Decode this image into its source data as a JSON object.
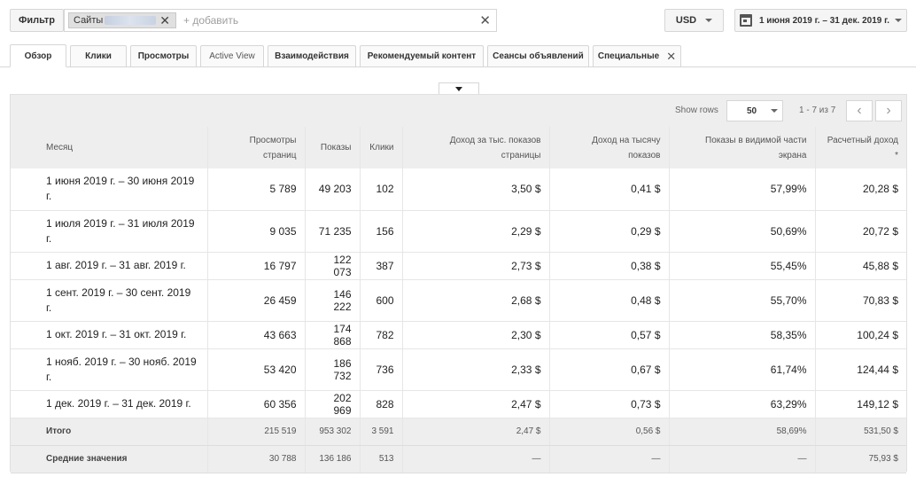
{
  "toolbar": {
    "filter_label": "Фильтр",
    "chip_label": "Сайты",
    "add_placeholder": "+ добавить",
    "currency": "USD",
    "date_range": "1 июня 2019 г. – 31 дек. 2019 г."
  },
  "tabs": [
    {
      "label": "Обзор"
    },
    {
      "label": "Клики"
    },
    {
      "label": "Просмотры"
    },
    {
      "label": "Active View"
    },
    {
      "label": "Взаимодействия"
    },
    {
      "label": "Рекомендуемый контент"
    },
    {
      "label": "Сеансы объявлений"
    },
    {
      "label": "Специальные"
    }
  ],
  "pagination": {
    "show_rows_label": "Show rows",
    "rows_value": "50",
    "range": "1 - 7 из 7"
  },
  "table": {
    "headers": {
      "month": "Месяц",
      "pageviews": "Просмотры страниц",
      "impressions": "Показы",
      "clicks": "Клики",
      "page_rpm": "Доход за тыс. показов страницы",
      "impr_rpm": "Доход на тысячу показов",
      "viewability": "Показы в видимой части экрана",
      "revenue": "Расчетный доход *"
    },
    "rows": [
      {
        "month": "1 июня 2019 г. – 30 июня 2019 г.",
        "pageviews": "5 789",
        "impressions": "49 203",
        "clicks": "102",
        "page_rpm": "3,50 $",
        "impr_rpm": "0,41 $",
        "viewability": "57,99%",
        "revenue": "20,28 $"
      },
      {
        "month": "1 июля 2019 г. – 31 июля 2019 г.",
        "pageviews": "9 035",
        "impressions": "71 235",
        "clicks": "156",
        "page_rpm": "2,29 $",
        "impr_rpm": "0,29 $",
        "viewability": "50,69%",
        "revenue": "20,72 $"
      },
      {
        "month": "1 авг. 2019 г. – 31 авг. 2019 г.",
        "pageviews": "16 797",
        "impressions": "122 073",
        "clicks": "387",
        "page_rpm": "2,73 $",
        "impr_rpm": "0,38 $",
        "viewability": "55,45%",
        "revenue": "45,88 $"
      },
      {
        "month": "1 сент. 2019 г. – 30 сент. 2019 г.",
        "pageviews": "26 459",
        "impressions": "146 222",
        "clicks": "600",
        "page_rpm": "2,68 $",
        "impr_rpm": "0,48 $",
        "viewability": "55,70%",
        "revenue": "70,83 $"
      },
      {
        "month": "1 окт. 2019 г. – 31 окт. 2019 г.",
        "pageviews": "43 663",
        "impressions": "174 868",
        "clicks": "782",
        "page_rpm": "2,30 $",
        "impr_rpm": "0,57 $",
        "viewability": "58,35%",
        "revenue": "100,24 $"
      },
      {
        "month": "1 нояб. 2019 г. – 30 нояб. 2019 г.",
        "pageviews": "53 420",
        "impressions": "186 732",
        "clicks": "736",
        "page_rpm": "2,33 $",
        "impr_rpm": "0,67 $",
        "viewability": "61,74%",
        "revenue": "124,44 $"
      },
      {
        "month": "1 дек. 2019 г. – 31 дек. 2019 г.",
        "pageviews": "60 356",
        "impressions": "202 969",
        "clicks": "828",
        "page_rpm": "2,47 $",
        "impr_rpm": "0,73 $",
        "viewability": "63,29%",
        "revenue": "149,12 $"
      }
    ],
    "total": {
      "month": "Итого",
      "pageviews": "215 519",
      "impressions": "953 302",
      "clicks": "3 591",
      "page_rpm": "2,47 $",
      "impr_rpm": "0,56 $",
      "viewability": "58,69%",
      "revenue": "531,50 $"
    },
    "average": {
      "month": "Средние значения",
      "pageviews": "30 788",
      "impressions": "136 186",
      "clicks": "513",
      "page_rpm": "—",
      "impr_rpm": "—",
      "viewability": "—",
      "revenue": "75,93 $"
    }
  }
}
